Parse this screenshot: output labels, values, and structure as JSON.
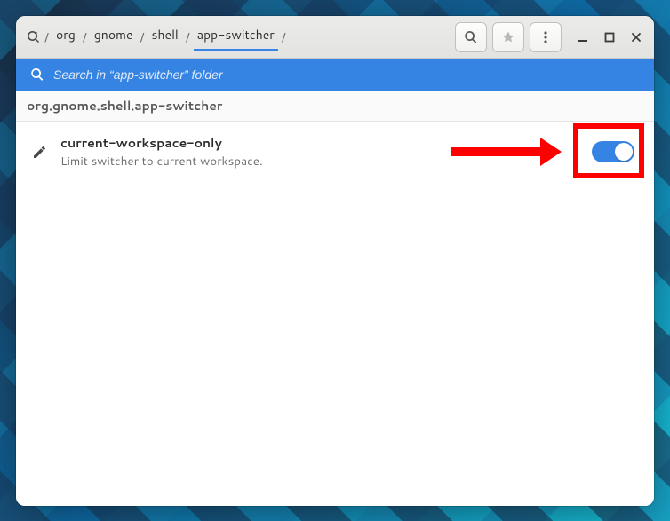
{
  "breadcrumb": {
    "items": [
      "org",
      "gnome",
      "shell",
      "app-switcher"
    ],
    "active_index": 3
  },
  "toolbar": {
    "search_button": "Search",
    "star_button": "Bookmark",
    "menu_button": "Menu"
  },
  "window_controls": {
    "minimize": "Minimize",
    "maximize": "Maximize",
    "close": "Close"
  },
  "search": {
    "placeholder": "Search in “app-switcher” folder"
  },
  "schema_path": "org.gnome.shell.app-switcher",
  "setting": {
    "key": "current-workspace-only",
    "description": "Limit switcher to current workspace.",
    "value": true
  },
  "colors": {
    "accent": "#3584e4",
    "highlight": "#ff0000"
  }
}
